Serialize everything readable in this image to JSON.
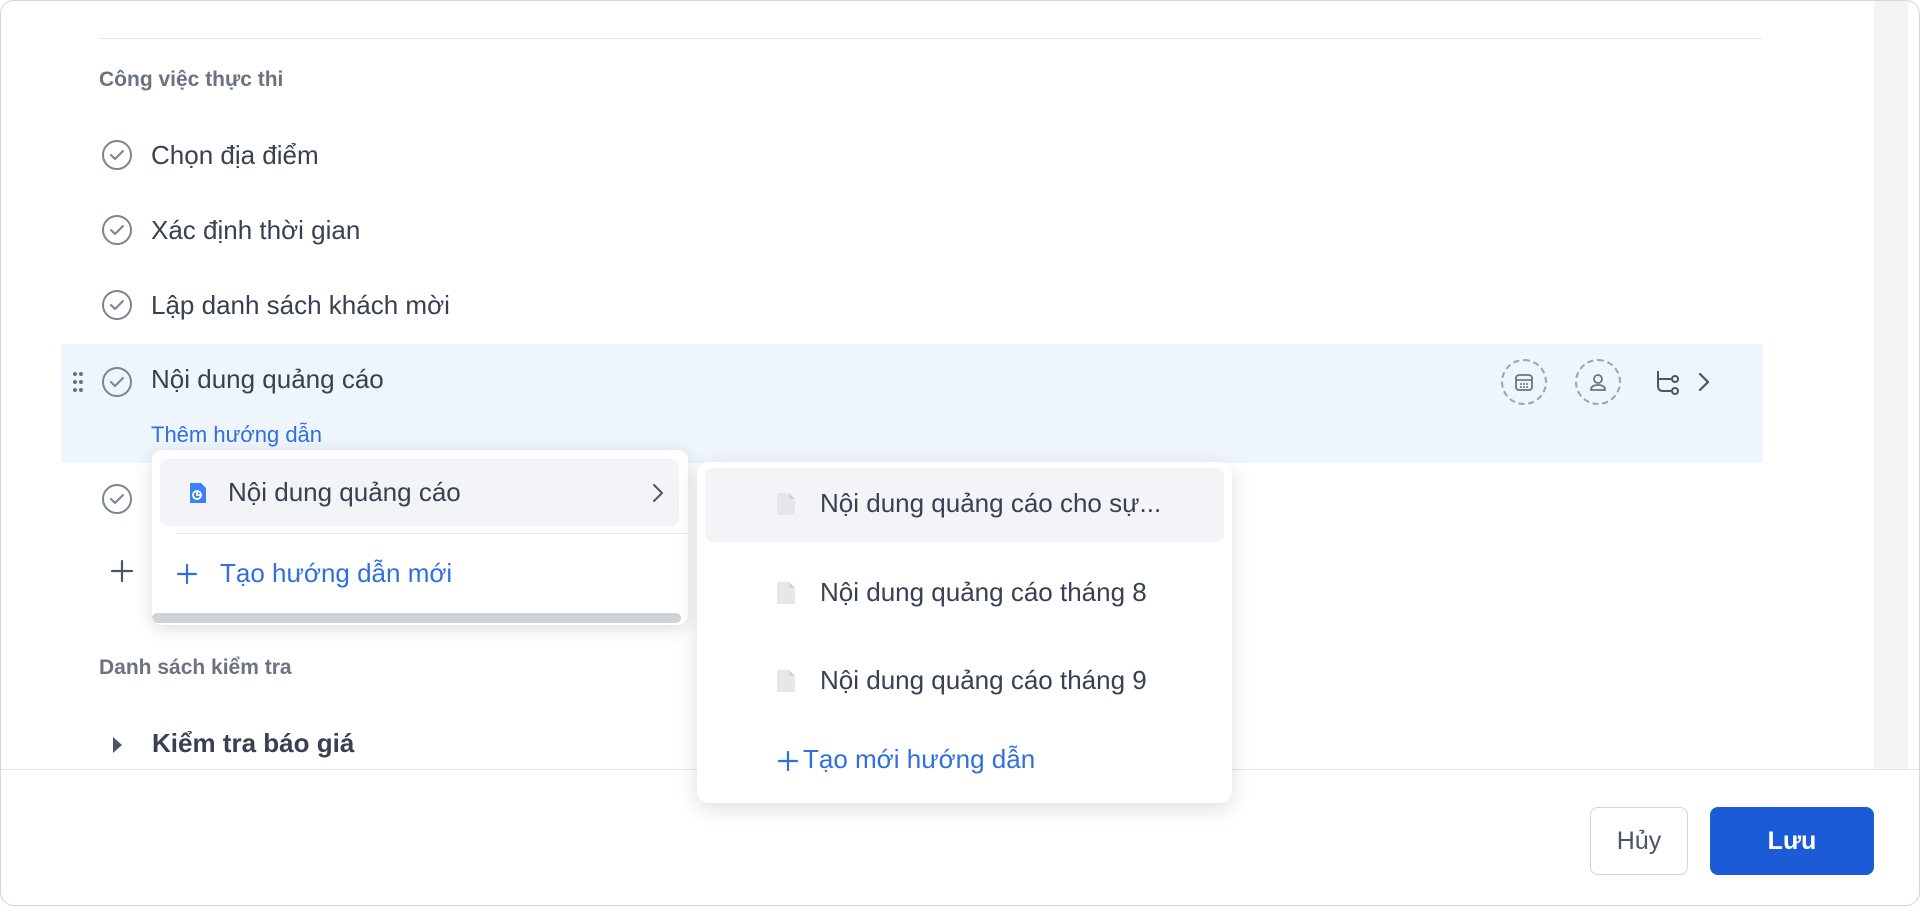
{
  "sections": {
    "execution_label": "Công việc thực thi",
    "checklist_label": "Danh sách kiểm tra"
  },
  "tasks": [
    {
      "label": "Chọn địa điểm"
    },
    {
      "label": "Xác định thời gian"
    },
    {
      "label": "Lập danh sách khách mời"
    },
    {
      "label": "Nội dung quảng cáo",
      "add_guide_label": "Thêm hướng dẫn"
    }
  ],
  "guide_dropdown": {
    "guide_label": "Nội dung quảng cáo",
    "create_label": "Tạo hướng dẫn mới"
  },
  "guide_submenu": {
    "items": [
      {
        "label": "Nội dung quảng cáo cho sự..."
      },
      {
        "label": "Nội dung quảng cáo tháng 8"
      },
      {
        "label": "Nội dung quảng cáo tháng 9"
      }
    ],
    "create_label": "Tạo mới hướng dẫn"
  },
  "checklist": [
    {
      "label": "Kiểm tra báo giá"
    }
  ],
  "footer": {
    "cancel_label": "Hủy",
    "save_label": "Lưu"
  },
  "icons": {
    "task_check": "check-circle-icon",
    "drag": "drag-handle-icon",
    "calendar": "calendar-icon",
    "assignee": "user-icon",
    "subtasks": "subtask-icon",
    "chevron": "chevron-right-icon",
    "document": "document-icon",
    "plus": "plus-icon",
    "caret": "caret-right-icon"
  },
  "colors": {
    "accent": "#1c5bd6",
    "link": "#2f6fdf",
    "active_row": "#eef5fd"
  }
}
